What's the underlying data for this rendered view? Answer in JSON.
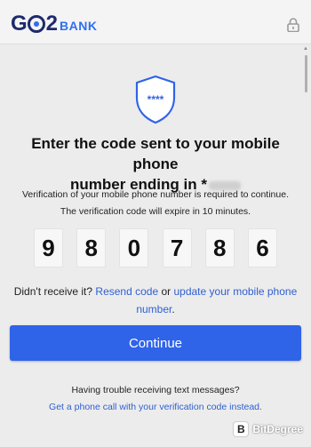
{
  "header": {
    "logo_main": "G2",
    "logo_main_left": "G",
    "logo_main_right": "2",
    "logo_bank": "BANK",
    "lock_icon": "lock-icon"
  },
  "page": {
    "shield_icon": "shield-icon",
    "shield_text": "****",
    "title": "Enter the code sent to your mobile phone number ending in *",
    "title_line1": "Enter the code sent to your mobile phone",
    "title_line2": "number ending in *",
    "subtext_line1": "Verification of your mobile phone number is required to continue.",
    "subtext_line2": "The verification code will expire in 10 minutes.",
    "digits": [
      "9",
      "8",
      "0",
      "7",
      "8",
      "6"
    ],
    "resend_prefix": "Didn't receive it?",
    "resend_link": "Resend code",
    "resend_or": "or",
    "update_link": "update your mobile phone number",
    "resend_suffix": ".",
    "continue_label": "Continue",
    "trouble_text": "Having trouble receiving text messages?",
    "phone_link": "Get a phone call with your verification code instead."
  },
  "watermark": {
    "box": "B",
    "text": "BitDegree"
  },
  "colors": {
    "brand_navy": "#1e2a6e",
    "brand_blue": "#2f6ff0",
    "button_blue": "#2f63e8",
    "link_blue": "#2f5fd0",
    "background": "#ececec"
  }
}
